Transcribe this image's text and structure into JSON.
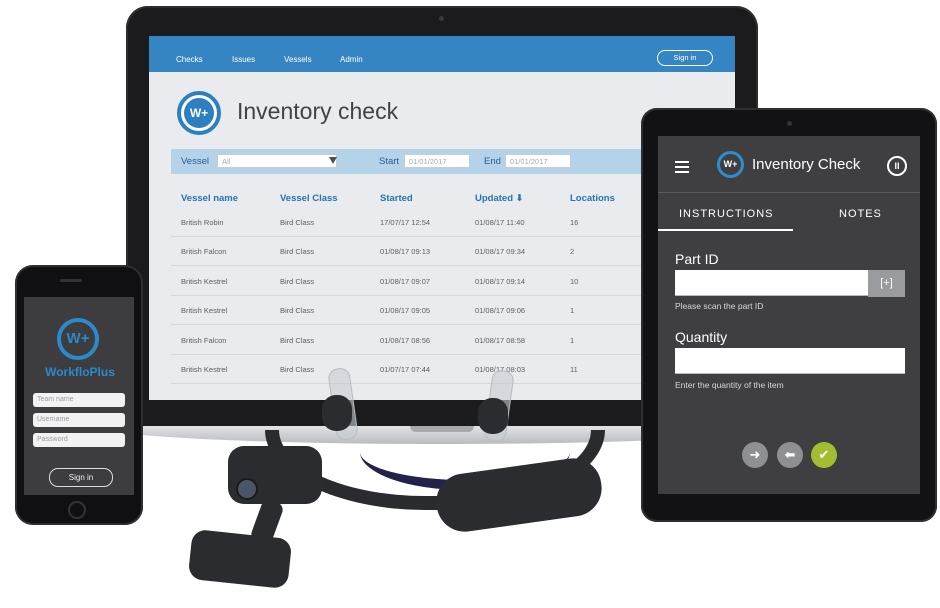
{
  "laptop": {
    "nav": [
      "Checks",
      "Issues",
      "Vessels",
      "Admin"
    ],
    "signin": "Sign in",
    "logo_text": "W+",
    "title": "Inventory check",
    "filters": {
      "vessel_label": "Vessel",
      "vessel_value": "All",
      "start_label": "Start",
      "start_value": "01/01/2017",
      "end_label": "End",
      "end_value": "01/01/2017"
    },
    "table": {
      "headers": [
        "Vessel name",
        "Vessel Class",
        "Started",
        "Updated ⬇",
        "Locations"
      ],
      "rows": [
        [
          "British Robin",
          "Bird Class",
          "17/07/17 12:54",
          "01/08/17 11:40",
          "16"
        ],
        [
          "British Falcon",
          "Bird Class",
          "01/08/17 09:13",
          "01/08/17 09:34",
          "2"
        ],
        [
          "British Kestrel",
          "Bird Class",
          "01/08/17 09:07",
          "01/08/17 09:14",
          "10"
        ],
        [
          "British Kestrel",
          "Bird Class",
          "01/08/17 09:05",
          "01/08/17 09:06",
          "1"
        ],
        [
          "British Falcon",
          "Bird Class",
          "01/08/17 08:56",
          "01/08/17 08:58",
          "1"
        ],
        [
          "British Kestrel",
          "Bird Class",
          "01/07/17 07:44",
          "01/08/17 08:03",
          "11"
        ]
      ]
    }
  },
  "phone": {
    "logo_text": "W+",
    "brand": "WorkfloPlus",
    "team_placeholder": "Team name",
    "username_placeholder": "Username",
    "password_placeholder": "Password",
    "signin": "Sign in"
  },
  "tablet": {
    "logo_text": "W+",
    "title": "Inventory Check",
    "pause_icon": "II",
    "tabs": [
      "INSTRUCTIONS",
      "NOTES"
    ],
    "part_label": "Part ID",
    "part_hint": "Please scan the part ID",
    "qty_label": "Quantity",
    "qty_hint": "Enter the quantity of the item",
    "scan_icon": "[+]",
    "btn_next": "➜",
    "btn_back": "⬅",
    "btn_done": "✔",
    "colors": {
      "next": "#8f9093",
      "back": "#8f9093",
      "done": "#a3bd31"
    }
  }
}
